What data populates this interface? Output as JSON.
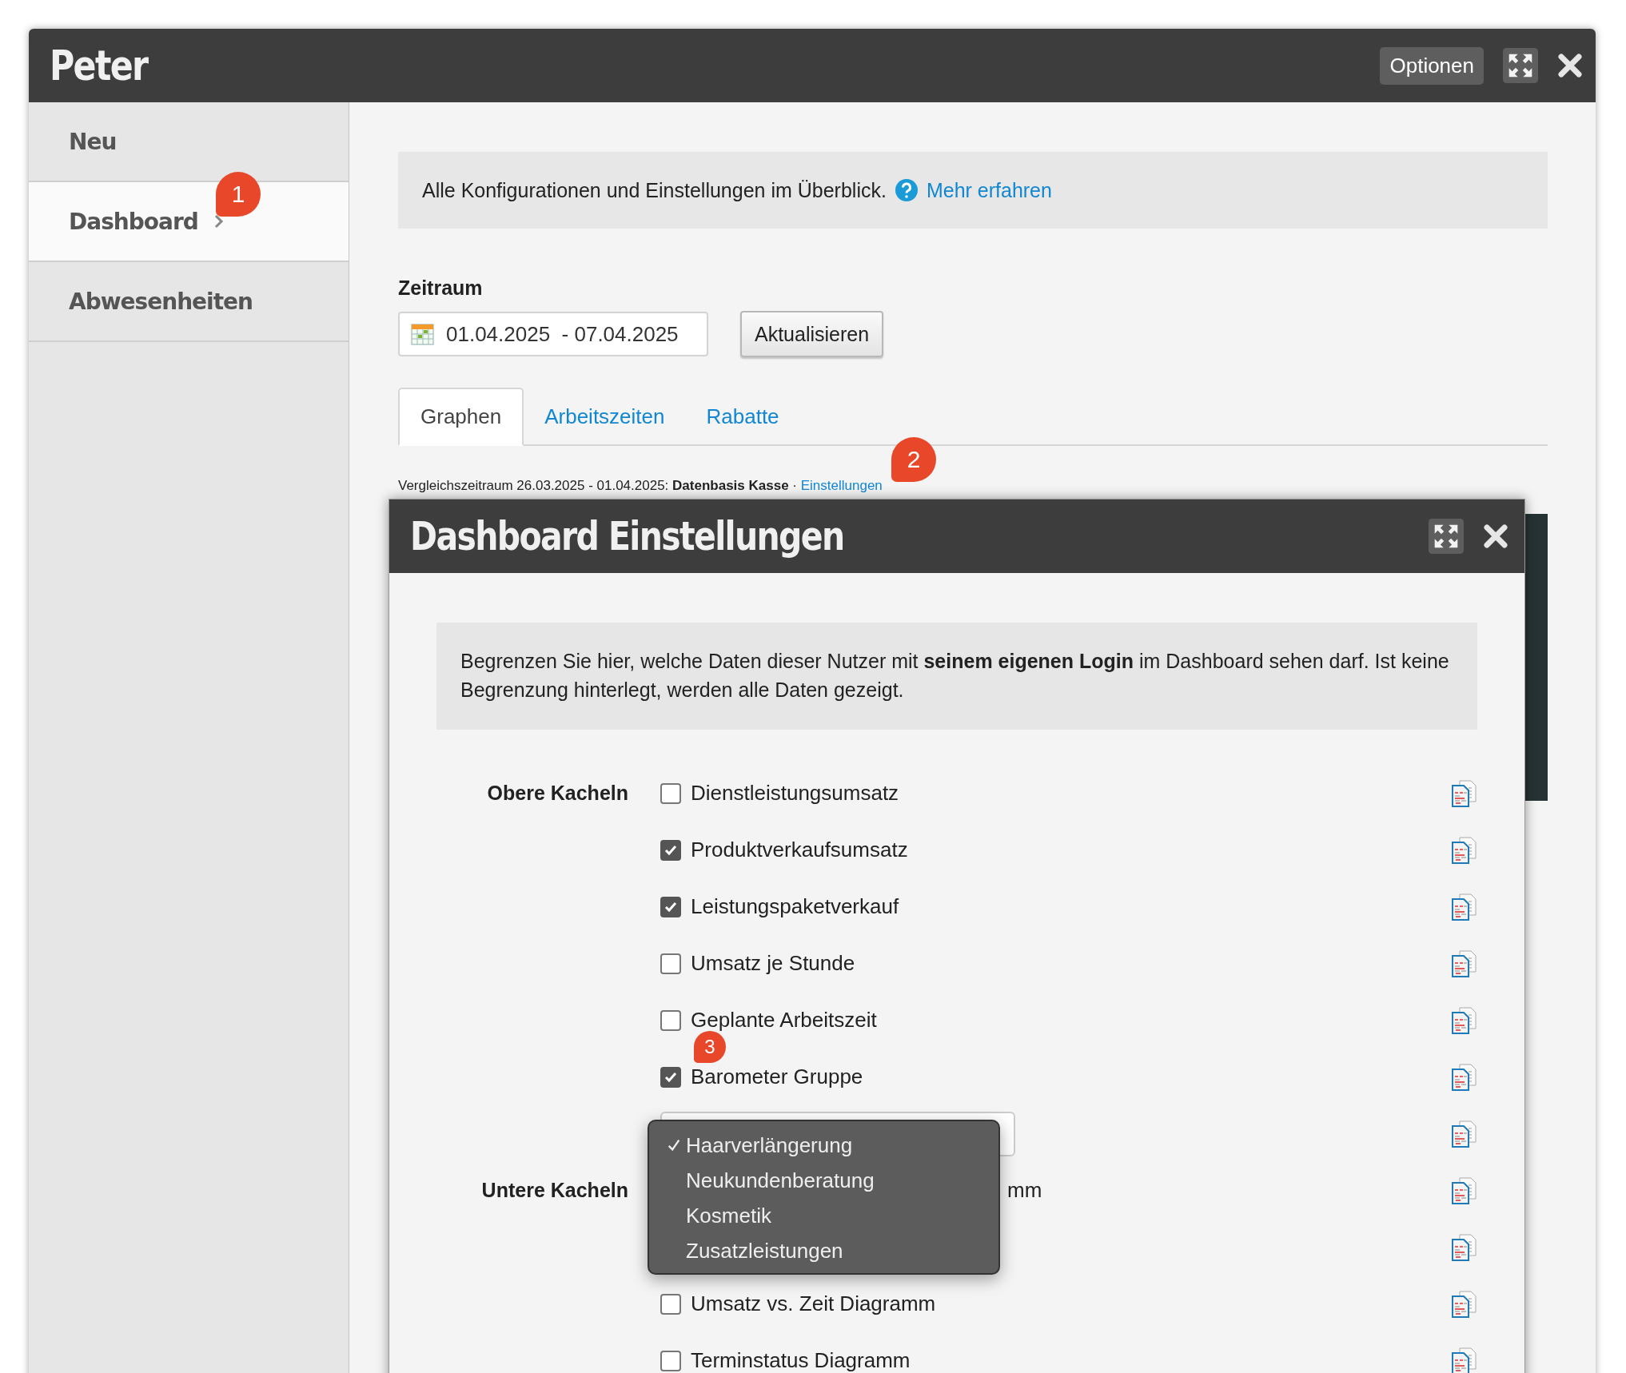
{
  "window": {
    "title": "Peter",
    "options_button": "Optionen"
  },
  "sidebar": {
    "items": [
      {
        "label": "Neu",
        "selected": false
      },
      {
        "label": "Dashboard",
        "selected": true
      },
      {
        "label": "Abwesenheiten",
        "selected": false
      }
    ]
  },
  "info": {
    "text": "Alle Konfigurationen und Einstellungen im Überblick.",
    "link": "Mehr erfahren"
  },
  "period": {
    "label": "Zeitraum",
    "value": "01.04.2025  - 07.04.2025",
    "button": "Aktualisieren"
  },
  "tabs": [
    {
      "label": "Graphen",
      "selected": true
    },
    {
      "label": "Arbeitszeiten",
      "selected": false
    },
    {
      "label": "Rabatte",
      "selected": false
    }
  ],
  "comparison": {
    "text": "Vergleichszeitraum 26.03.2025 - 01.04.2025: **Datenbasis Kasse** · ",
    "link": "Einstellungen"
  },
  "badges": [
    {
      "number": "1",
      "kind": "sidebar"
    },
    {
      "number": "2",
      "kind": "link"
    },
    {
      "number": "3",
      "kind": "row"
    }
  ],
  "dialog": {
    "title": "Dashboard Einstellungen",
    "notice": "Begrenzen Sie hier, welche Daten dieser Nutzer mit **seinem eigenen Login** im Dashboard sehen darf. Ist keine Begrenzung hinterlegt, werden alle Daten gezeigt.",
    "groups": [
      {
        "label": "Obere Kacheln",
        "rows": [
          {
            "kind": "checkbox",
            "label": "Dienstleistungsumsatz",
            "checked": false
          },
          {
            "kind": "checkbox",
            "label": "Produktverkaufsumsatz",
            "checked": true
          },
          {
            "kind": "checkbox",
            "label": "Leistungspaketverkauf",
            "checked": true
          },
          {
            "kind": "checkbox",
            "label": "Umsatz je Stunde",
            "checked": false
          },
          {
            "kind": "checkbox",
            "label": "Geplante Arbeitszeit",
            "checked": false
          },
          {
            "kind": "checkbox",
            "label": "Barometer Gruppe",
            "checked": true
          },
          {
            "kind": "select"
          }
        ]
      },
      {
        "label": "Untere Kacheln",
        "rows": [
          {
            "kind": "covered",
            "label": "mm"
          },
          {
            "kind": "covered"
          },
          {
            "kind": "checkbox",
            "label": "Umsatz vs. Zeit Diagramm",
            "checked": false
          },
          {
            "kind": "checkbox",
            "label": "Terminstatus Diagramm",
            "checked": false
          }
        ]
      }
    ],
    "dropdown": {
      "options": [
        {
          "label": "Haarverlängerung",
          "selected": true
        },
        {
          "label": "Neukundenberatung",
          "selected": false
        },
        {
          "label": "Kosmetik",
          "selected": false
        },
        {
          "label": "Zusatzleistungen",
          "selected": false
        }
      ]
    }
  }
}
